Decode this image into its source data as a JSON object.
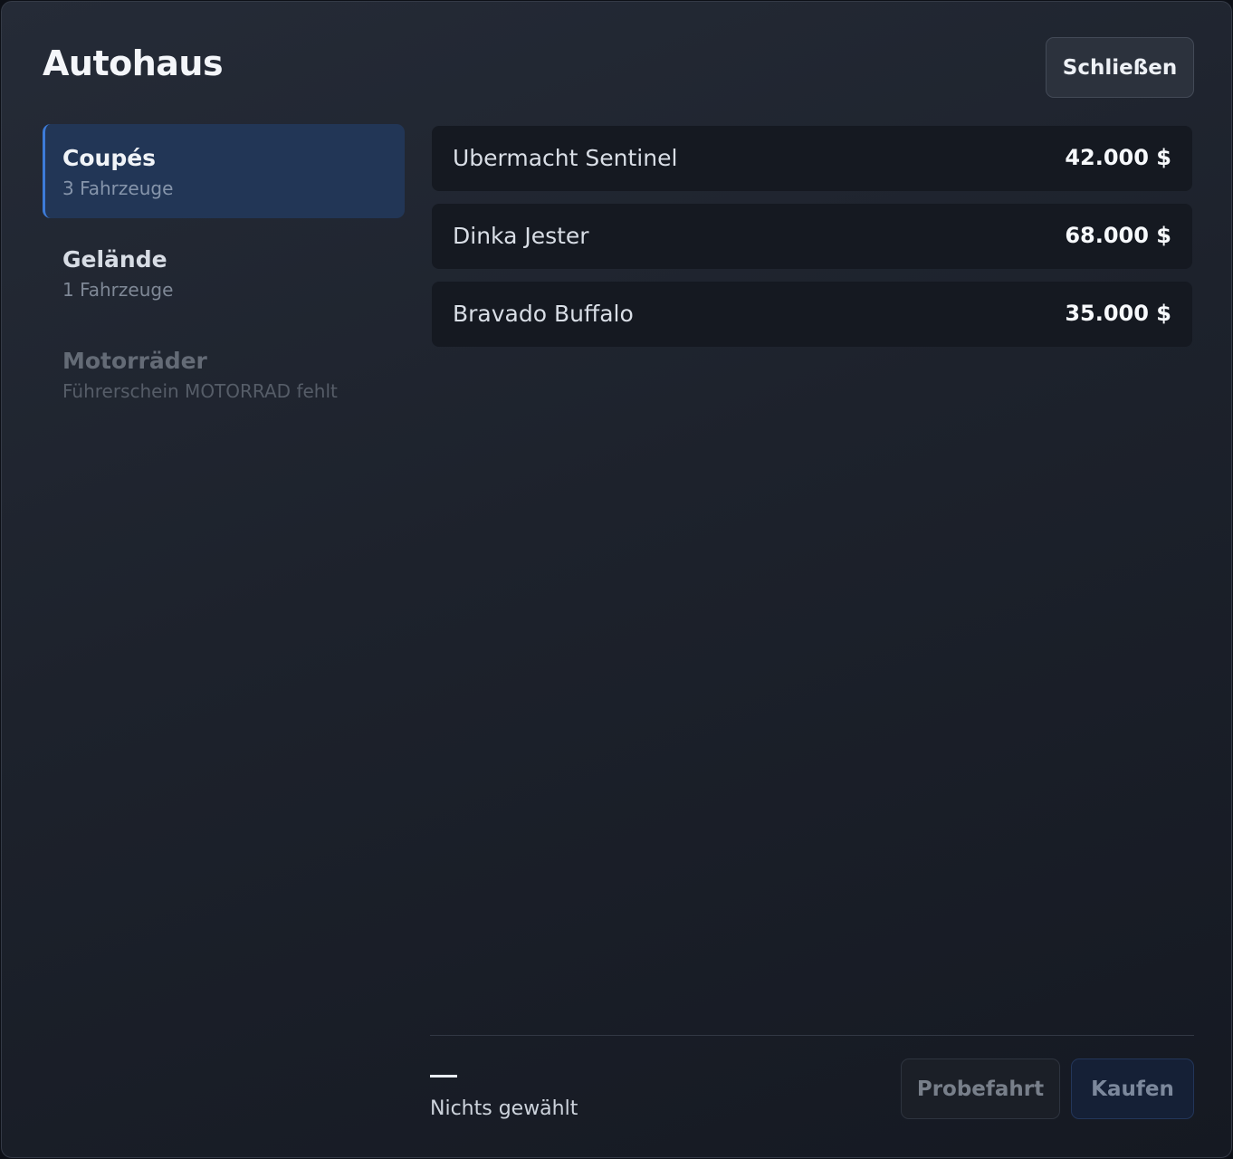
{
  "header": {
    "title": "Autohaus",
    "close_label": "Schließen"
  },
  "categories": [
    {
      "name": "Coupés",
      "sub": "3 Fahrzeuge",
      "active": true,
      "disabled": false
    },
    {
      "name": "Gelände",
      "sub": "1 Fahrzeuge",
      "active": false,
      "disabled": false
    },
    {
      "name": "Motorräder",
      "sub": "Führerschein MOTORRAD fehlt",
      "active": false,
      "disabled": true
    }
  ],
  "vehicles": [
    {
      "name": "Ubermacht Sentinel",
      "price": "42.000 $"
    },
    {
      "name": "Dinka Jester",
      "price": "68.000 $"
    },
    {
      "name": "Bravado Buffalo",
      "price": "35.000 $"
    }
  ],
  "selection": {
    "dash": "—",
    "text": "Nichts gewählt"
  },
  "actions": {
    "test_drive_label": "Probefahrt",
    "buy_label": "Kaufen"
  },
  "colors": {
    "accent": "#3d7bd8",
    "active_bg": "#223656"
  }
}
